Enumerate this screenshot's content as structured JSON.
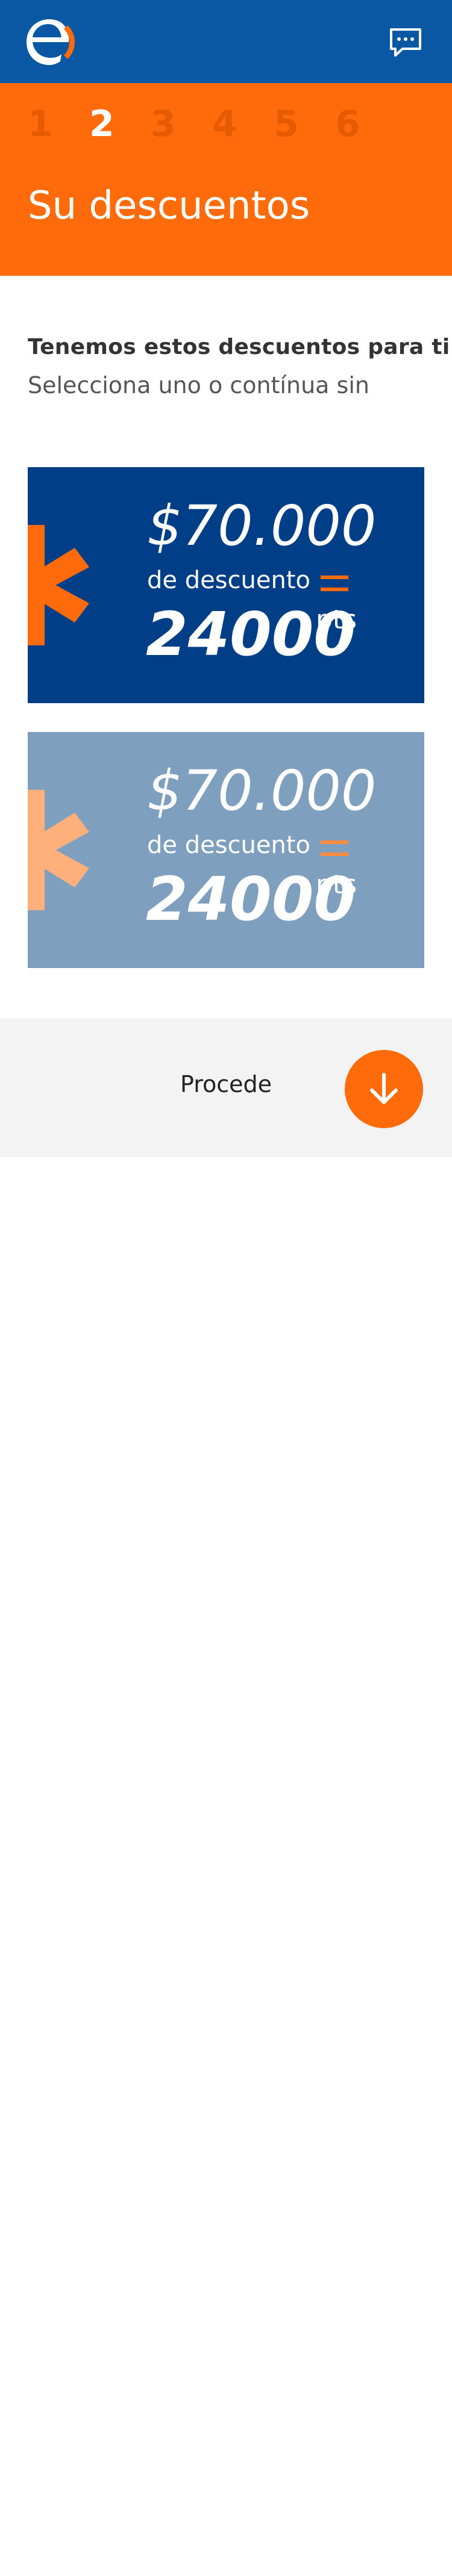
{
  "header": {
    "logo_icon": "enel-logo-icon",
    "chat_icon": "chat-bubble-icon",
    "background_color": "#0a57a4"
  },
  "steps": {
    "items": [
      "1",
      "2",
      "3",
      "4",
      "5",
      "6"
    ],
    "active_index": 1,
    "title": "Su descuentos",
    "background_color": "#ff6b0b"
  },
  "intro": {
    "title": "Tenemos estos descuentos para ti",
    "subtitle": "Selecciona uno o contínua sin"
  },
  "offers": [
    {
      "amount": "$70.000",
      "label": "de descuento",
      "points": "24000",
      "points_unit": "pts",
      "background_color": "#003f87",
      "state": "selected"
    },
    {
      "amount": "$70.000",
      "label": "de descuento",
      "points": "24000",
      "points_unit": "pts",
      "background_color": "#7f9fbf",
      "state": "unselected"
    }
  ],
  "footer": {
    "proceed_label": "Procede",
    "proceed_icon": "arrow-down-icon",
    "accent_color": "#ff6b0b"
  }
}
